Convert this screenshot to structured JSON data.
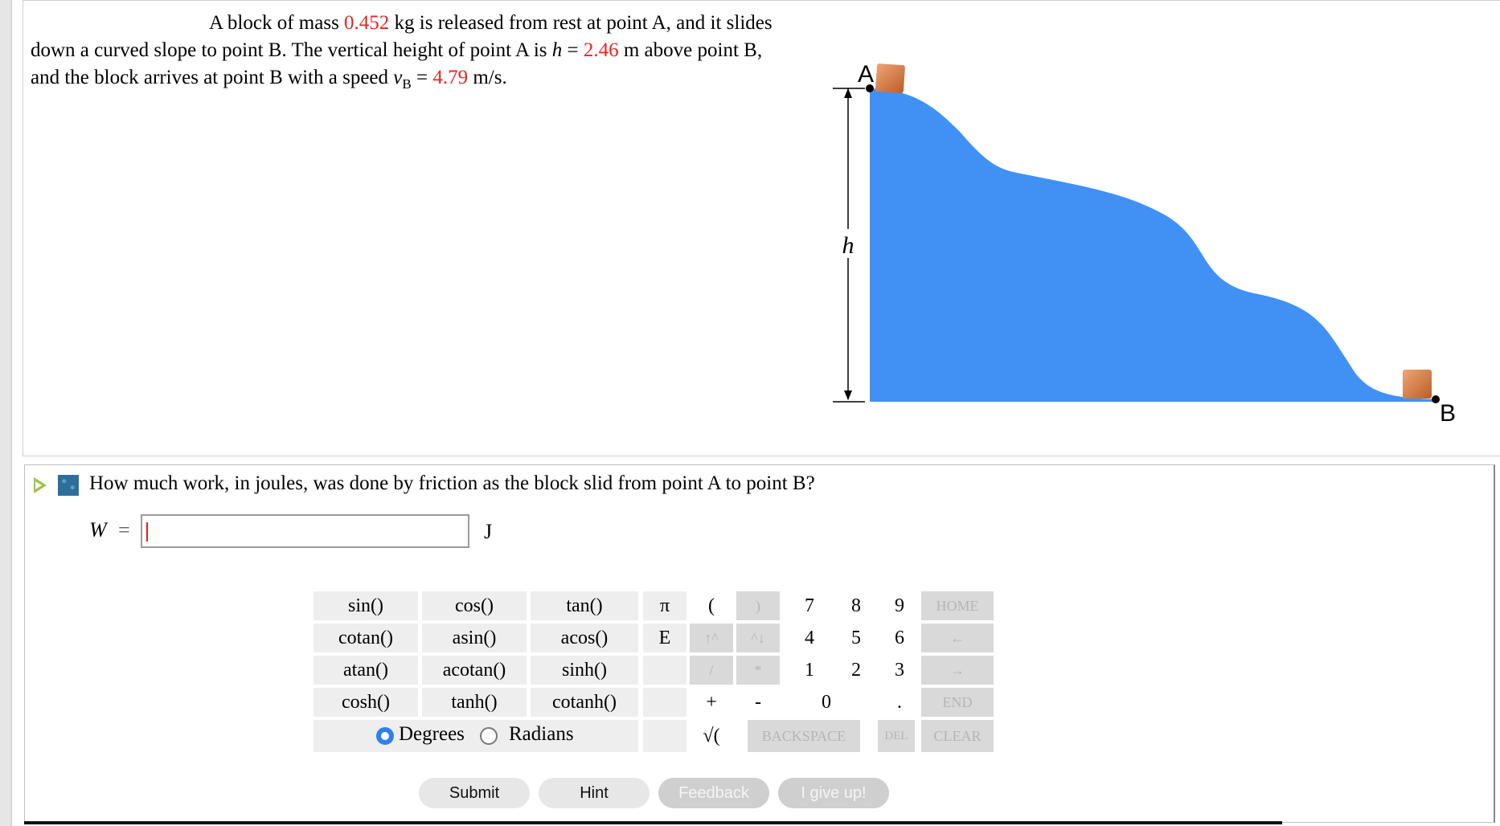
{
  "problem": {
    "p1": "A block of mass ",
    "mass": "0.452",
    "p2": " kg is released from rest at point A, and it slides down a curved slope to point B. The vertical height of point A is ",
    "h_var": "h",
    "p3": " = ",
    "height": "2.46",
    "p4": " m above point B, and the block arrives at point B with a speed ",
    "v_var": "v",
    "v_sub": "B",
    "p5": " = ",
    "speed": "4.79",
    "p6": " m/s."
  },
  "diagram": {
    "label_a": "A",
    "label_b": "B",
    "label_h": "h",
    "slope_color": "#4191f5",
    "block_color": "#d2804a"
  },
  "question": {
    "text": "How much work, in joules, was done by friction as the block slid from point A to point B?",
    "var": "W",
    "eq": "=",
    "value": "",
    "unit": "J"
  },
  "keypad": {
    "func": [
      [
        "sin()",
        "cos()",
        "tan()"
      ],
      [
        "cotan()",
        "asin()",
        "acos()"
      ],
      [
        "atan()",
        "acotan()",
        "sinh()"
      ],
      [
        "cosh()",
        "tanh()",
        "cotanh()"
      ]
    ],
    "const": [
      "π",
      "E"
    ],
    "ops": {
      "lparen": "(",
      "rparen": ")",
      "up": "↑^",
      "down": "^↓",
      "div": "/",
      "mul": "*",
      "plus": "+",
      "minus": "-",
      "sqrt": "√(",
      "backspace": "BACKSPACE",
      "del": "DEL",
      "clear": "CLEAR",
      "home": "HOME",
      "left": "←",
      "right": "→",
      "end": "END",
      "dot": "."
    },
    "digits": [
      "7",
      "8",
      "9",
      "4",
      "5",
      "6",
      "1",
      "2",
      "3",
      "0"
    ],
    "degrees": "Degrees",
    "radians": "Radians",
    "angle_mode": "Degrees"
  },
  "buttons": {
    "submit": "Submit",
    "hint": "Hint",
    "feedback": "Feedback",
    "giveup": "I give up!"
  }
}
